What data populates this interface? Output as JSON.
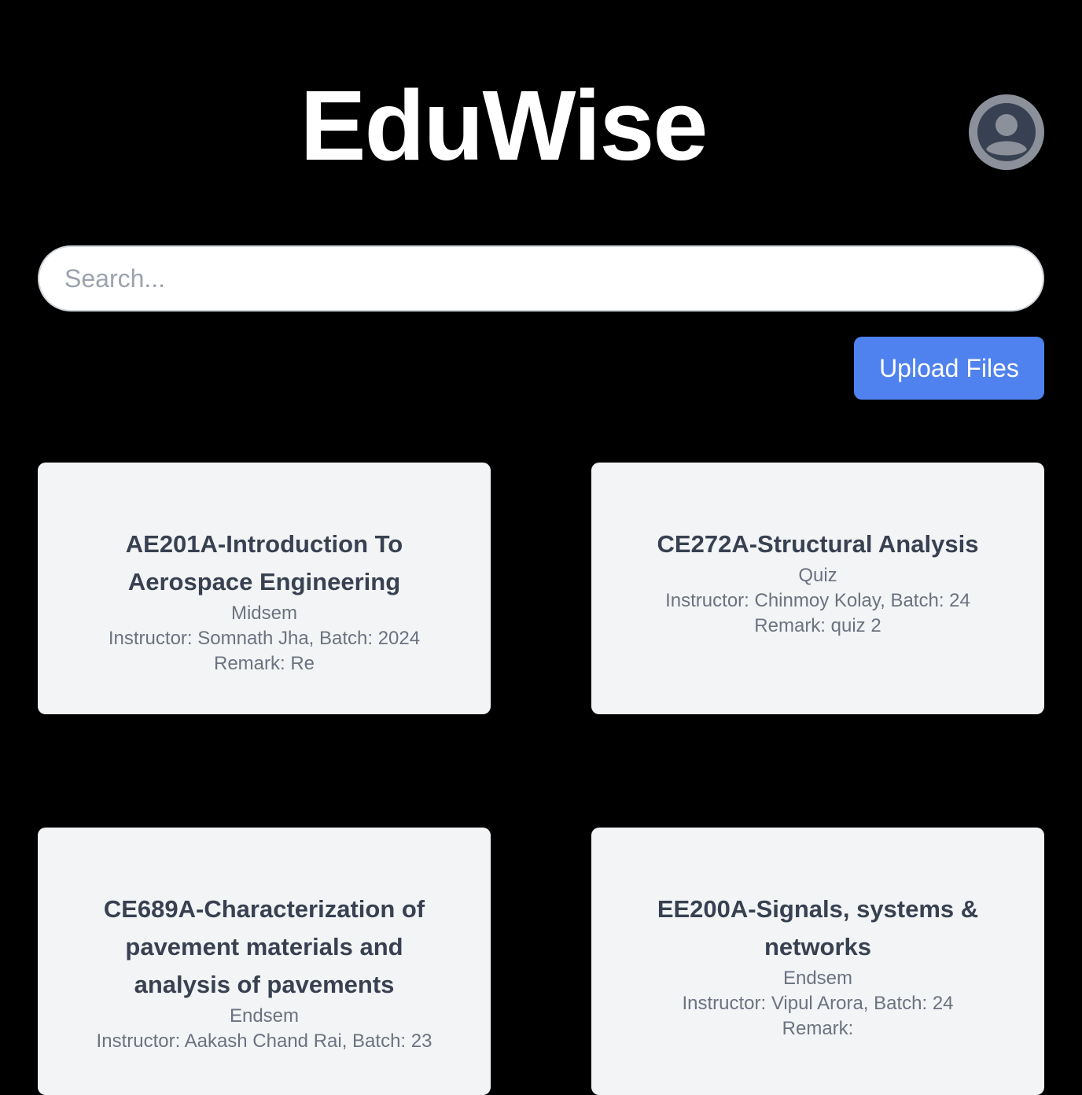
{
  "header": {
    "app_title": "EduWise",
    "profile_icon": "user-circle-icon"
  },
  "search": {
    "placeholder": "Search...",
    "value": ""
  },
  "toolbar": {
    "upload_label": "Upload Files"
  },
  "cards": [
    {
      "title": "AE201A-Introduction To Aerospace Engineering",
      "exam_type": "Midsem",
      "details": "Instructor: Somnath Jha, Batch: 2024",
      "remark": "Remark: Re"
    },
    {
      "title": "CE272A-Structural Analysis",
      "exam_type": "Quiz",
      "details": "Instructor: Chinmoy Kolay, Batch: 24",
      "remark": "Remark: quiz 2"
    },
    {
      "title": "CE689A-Characterization of pavement materials and analysis of pavements",
      "exam_type": "Endsem",
      "details": "Instructor: Aakash Chand Rai, Batch: 23",
      "remark": ""
    },
    {
      "title": "EE200A-Signals, systems & networks",
      "exam_type": "Endsem",
      "details": "Instructor: Vipul Arora, Batch: 24",
      "remark": "Remark:"
    }
  ]
}
